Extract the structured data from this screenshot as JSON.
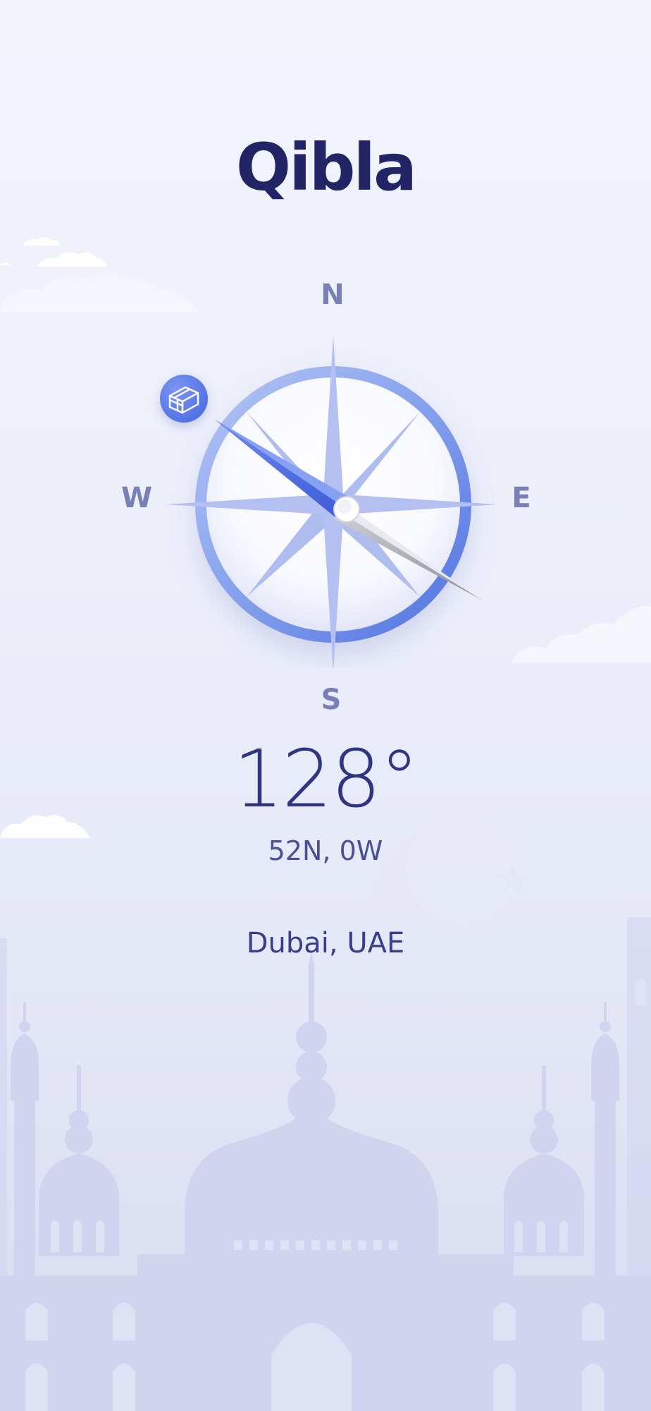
{
  "app": {
    "title": "Qibla"
  },
  "compass": {
    "north_label": "N",
    "south_label": "S",
    "east_label": "E",
    "west_label": "W",
    "heading_degrees": 128,
    "qibla_icon": "kaaba-icon"
  },
  "readout": {
    "degrees_text": "128°",
    "coordinates_text": "52N, 0W",
    "location_text": "Dubai, UAE"
  },
  "colors": {
    "title": "#222465",
    "accent_blue": "#5573e6",
    "cardinal_label": "#7880b8",
    "background": "#eef0fa",
    "silhouette": "#cfd3ee"
  }
}
